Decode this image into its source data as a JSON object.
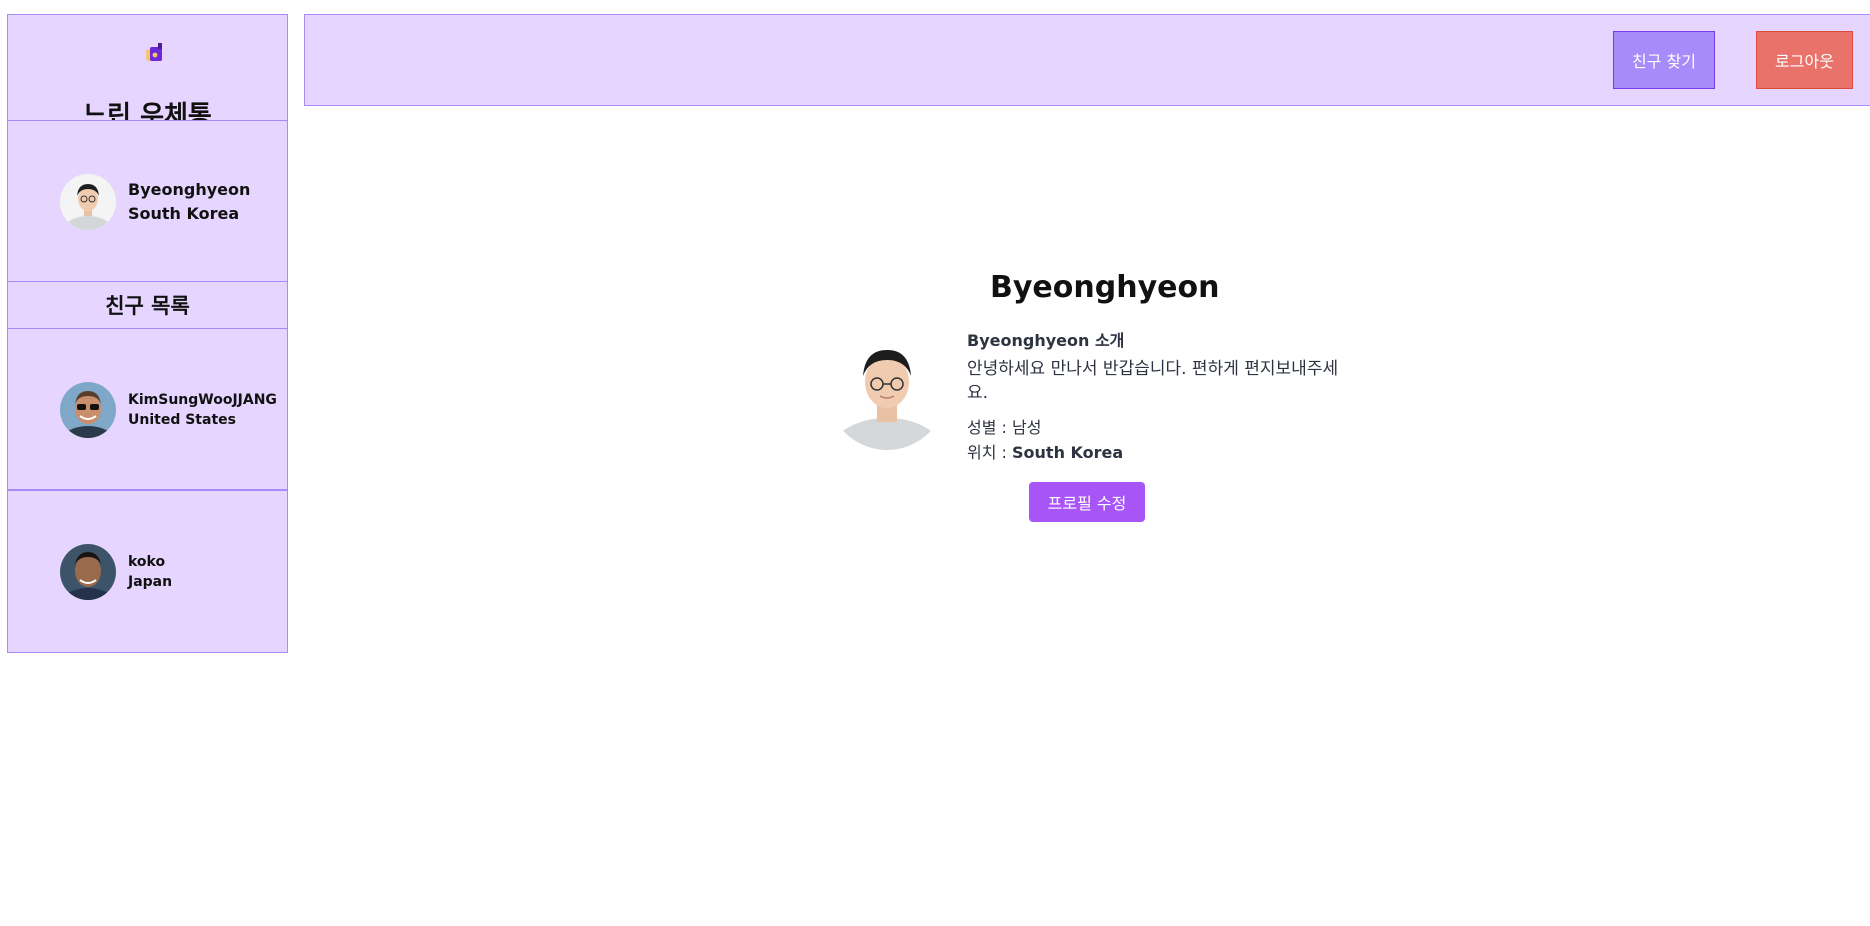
{
  "app": {
    "title": "느린 우체통"
  },
  "me": {
    "name": "Byeonghyeon",
    "country": "South Korea"
  },
  "friends_header": "친구 목록",
  "friends": [
    {
      "name": "KimSungWooJJANG",
      "country": "United States"
    },
    {
      "name": "koko",
      "country": "Japan"
    }
  ],
  "topbar": {
    "find_friends": "친구 찾기",
    "logout": "로그아웃"
  },
  "profile": {
    "name": "Byeonghyeon",
    "intro_title": "Byeonghyeon 소개",
    "intro_text": "안녕하세요 만나서 반갑습니다. 편하게 편지보내주세요.",
    "gender_label": "성별 :",
    "gender_value": "남성",
    "location_label": "위치 :",
    "location_value": "South Korea",
    "edit_button": "프로필 수정"
  },
  "colors": {
    "panel_bg": "#e5d5ff",
    "panel_border": "#a78bfa",
    "find_friends_btn": "#a78bfa",
    "logout_btn": "#e9736b",
    "edit_btn": "#a855f7"
  },
  "icons": {
    "logo": "mailbox-logo-icon"
  }
}
